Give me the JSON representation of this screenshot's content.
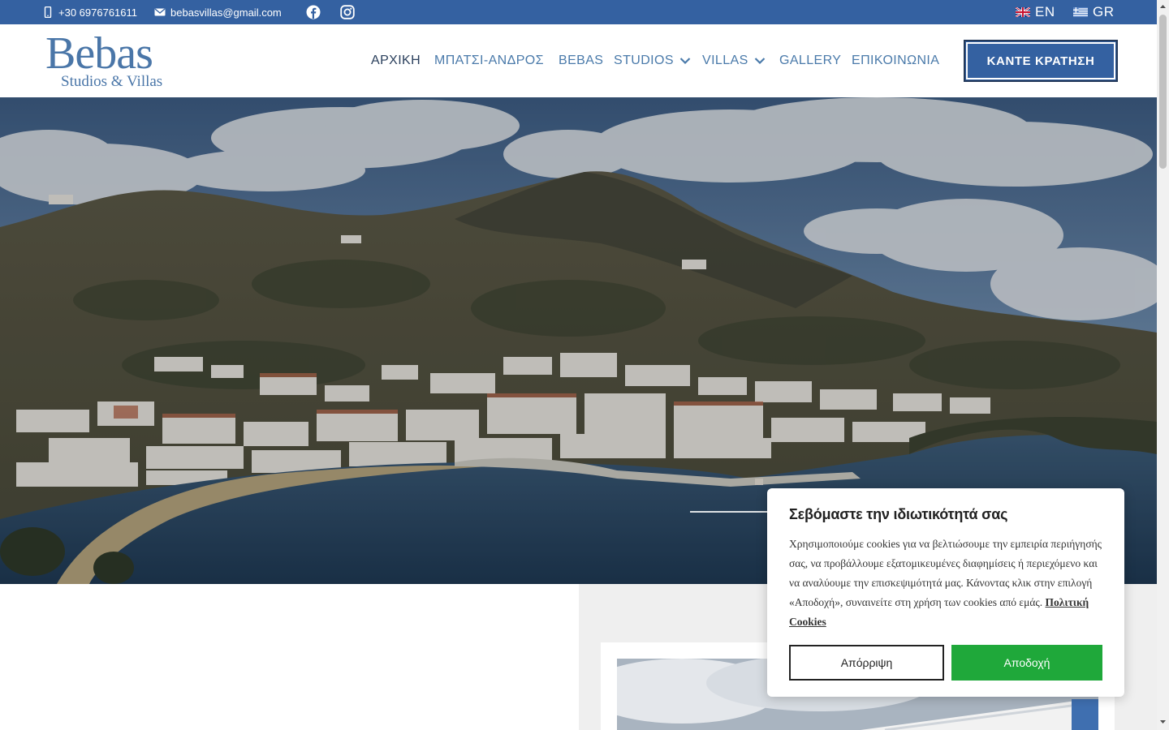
{
  "topbar": {
    "phone": "+30 6976761611",
    "email": "bebasvillas@gmail.com",
    "social": [
      "facebook-icon",
      "instagram-icon"
    ],
    "languages": [
      {
        "code": "EN",
        "flag": "uk-flag-icon"
      },
      {
        "code": "GR",
        "flag": "greece-flag-icon"
      }
    ],
    "bg_color": "#3461a1"
  },
  "logo": {
    "title": "Bebas",
    "subtitle": "Studios & Villas"
  },
  "nav": {
    "items": [
      {
        "label": "ΑΡΧΙΚΗ",
        "active": true
      },
      {
        "label": "ΜΠΑΤΣΙ-ΑΝΔΡΟΣ"
      },
      {
        "label": "BEBAS"
      },
      {
        "label": "STUDIOS",
        "dropdown": true
      },
      {
        "label": "VILLAS",
        "dropdown": true
      },
      {
        "label": "GALLERY"
      },
      {
        "label": "ΕΠΙΚΟΙΝΩΝΙΑ"
      }
    ],
    "book_button": "ΚΑΝΤΕ ΚΡΑΤΗΣΗ",
    "accent_color": "#3461a1"
  },
  "cookie": {
    "title": "Σεβόμαστε την ιδιωτικότητά σας",
    "text": "Χρησιμοποιούμε cookies για να βελτιώσουμε την εμπειρία περιήγησής σας, να προβάλλουμε εξατομικευμένες διαφημίσεις ή περιεχόμενο και να αναλύουμε την επισκεψιμότητά μας. Κάνοντας κλικ στην επιλογή «Αποδοχή», συναινείτε στη χρήση των cookies από εμάς.",
    "policy_link": "Πολιτική Cookies",
    "reject_label": "Απόρριψη",
    "accept_label": "Αποδοχή",
    "accept_color": "#1fa83a"
  }
}
